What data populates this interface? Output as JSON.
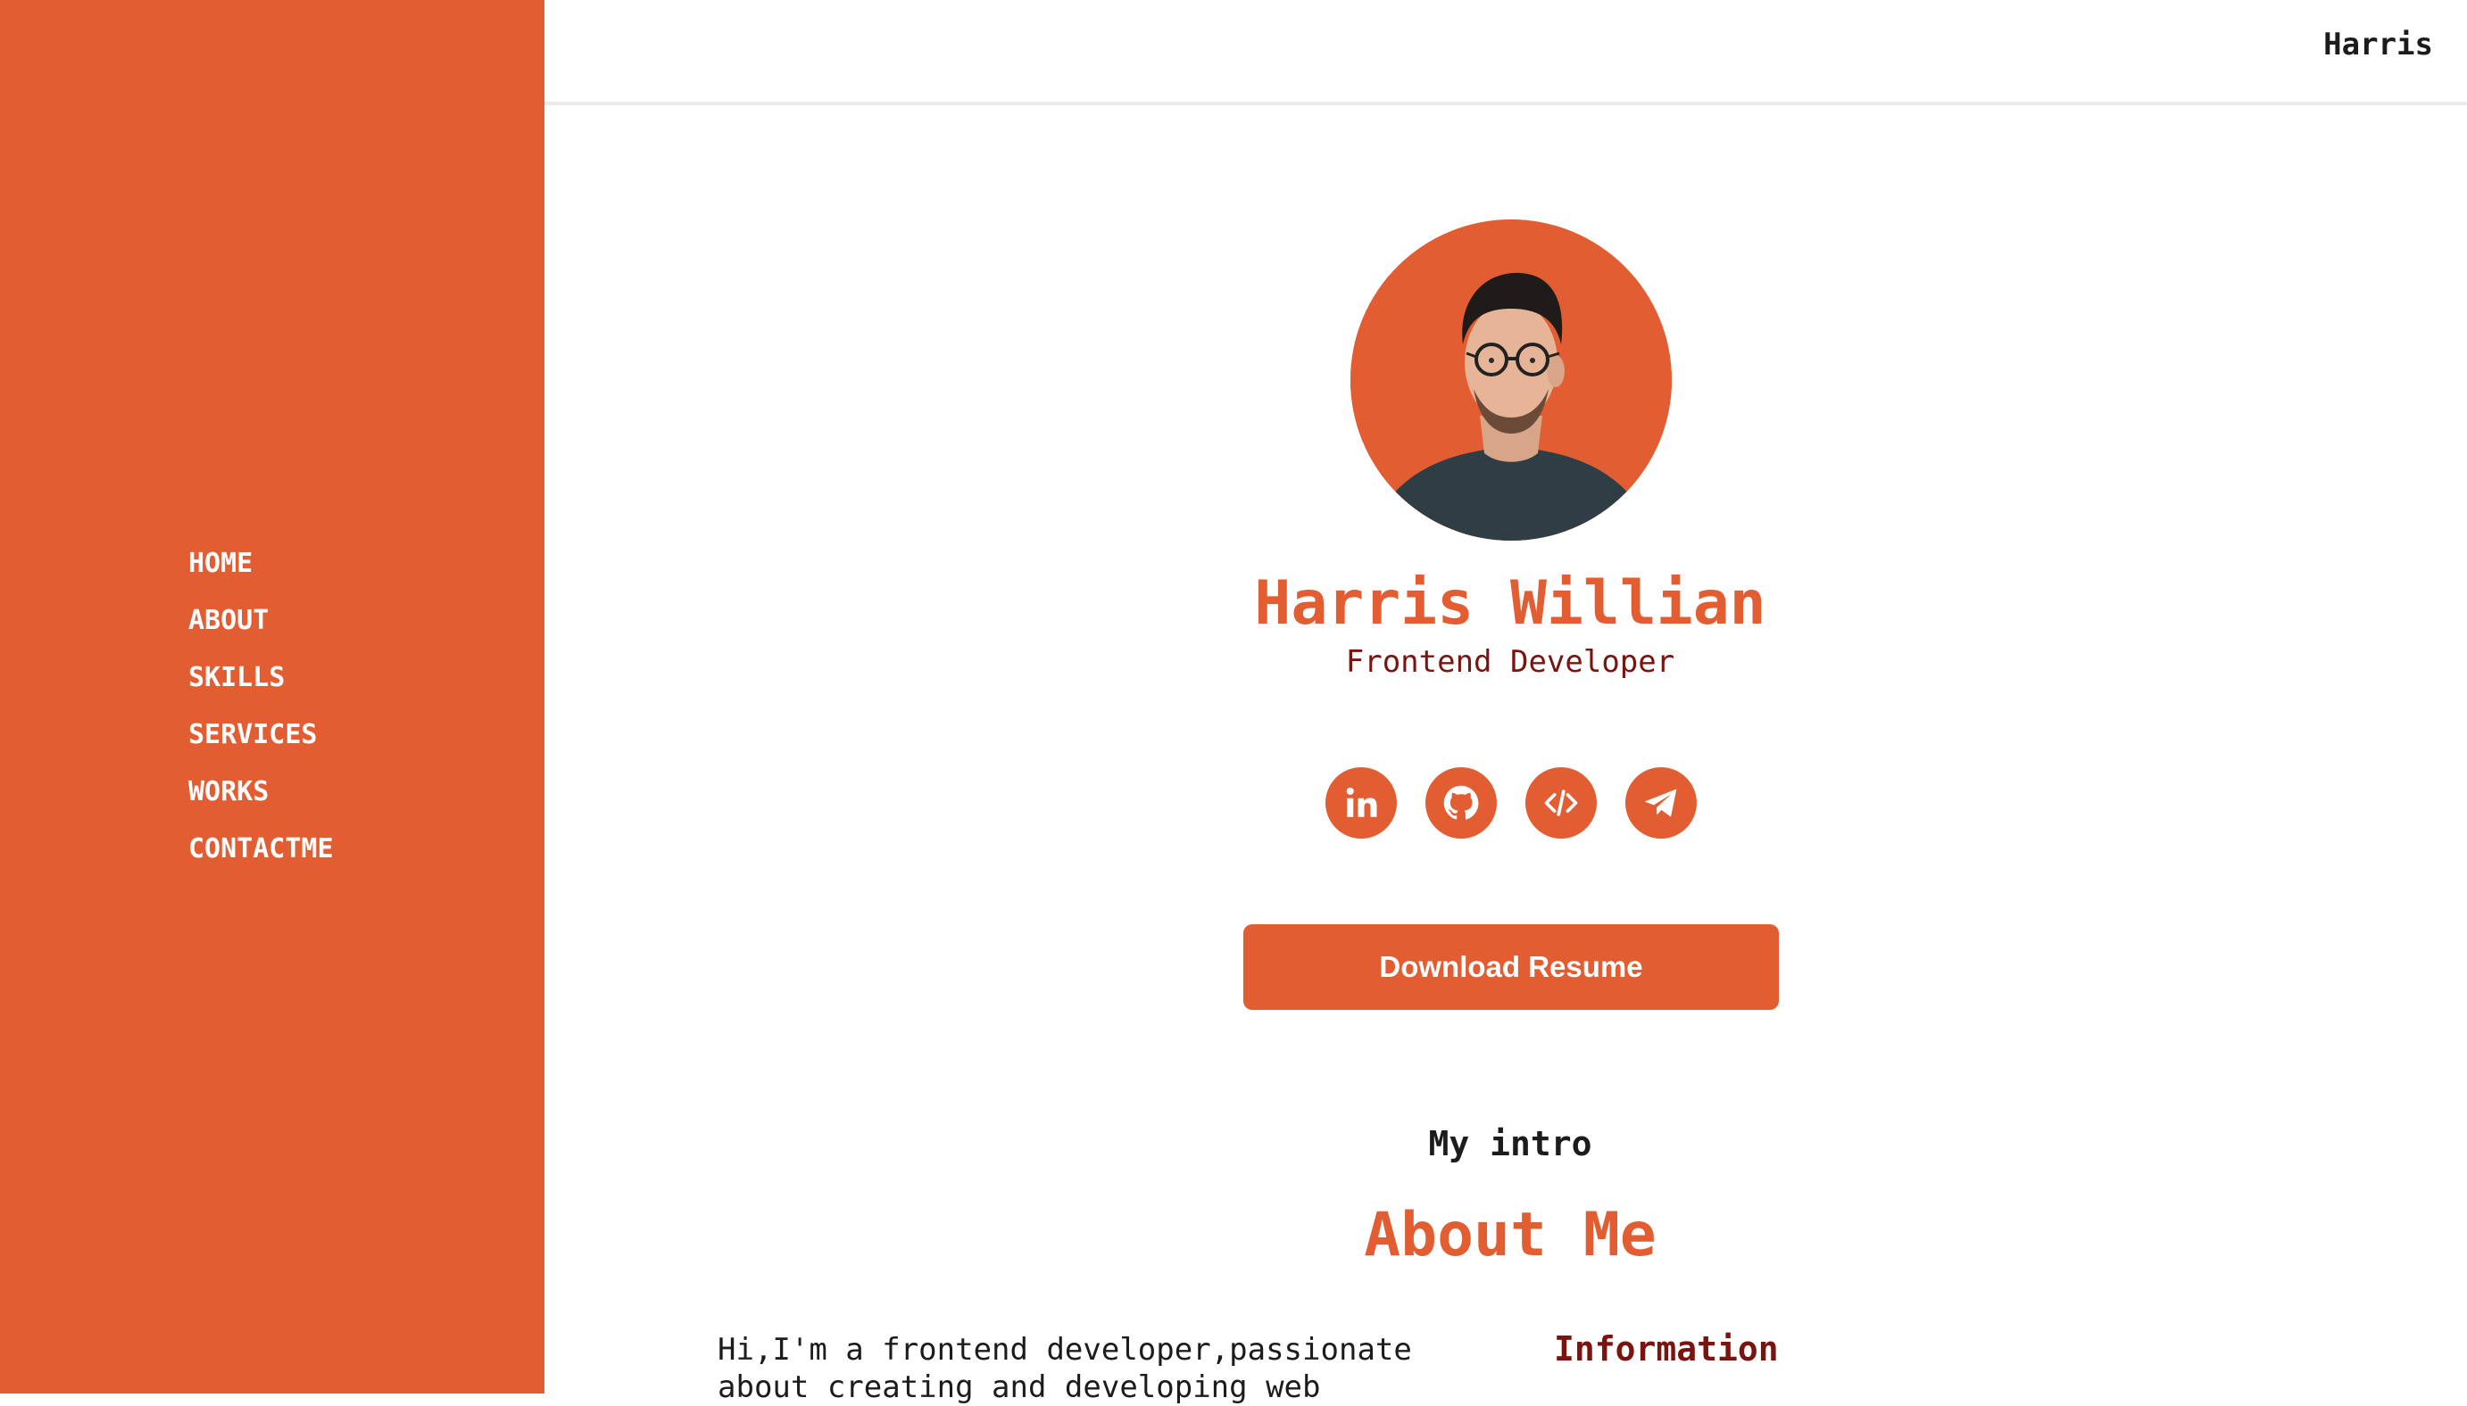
{
  "sidebar": {
    "nav": [
      "HOME",
      "ABOUT",
      "SKILLS",
      "SERVICES",
      "WORKS",
      "CONTACTME"
    ]
  },
  "header": {
    "brand": "Harris"
  },
  "profile": {
    "name": "Harris Willian",
    "role": "Frontend Developer",
    "socials": [
      "linkedin-icon",
      "github-icon",
      "code-icon",
      "telegram-icon"
    ],
    "download_label": "Download Resume"
  },
  "about": {
    "subtitle": "My intro",
    "title": "About Me",
    "text": "Hi,I'm a frontend developer,passionate about creating and developing web",
    "info_title": "Information"
  },
  "colors": {
    "accent": "#e25d32",
    "dark_red": "#7a1410",
    "text": "#1c1c1c"
  }
}
